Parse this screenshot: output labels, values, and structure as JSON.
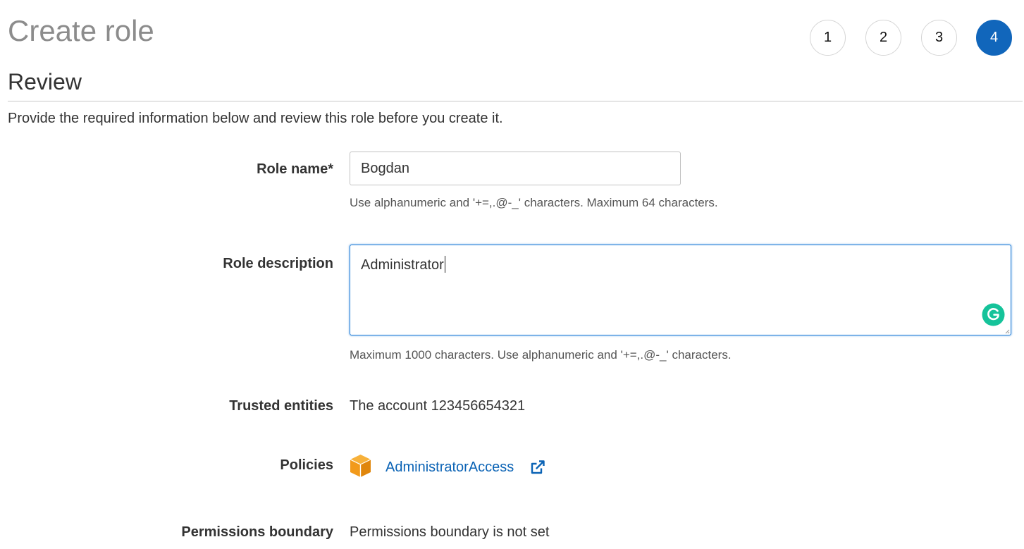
{
  "page": {
    "title": "Create role",
    "section_title": "Review",
    "intro": "Provide the required information below and review this role before you create it."
  },
  "steps": [
    {
      "label": "1",
      "active": false
    },
    {
      "label": "2",
      "active": false
    },
    {
      "label": "3",
      "active": false
    },
    {
      "label": "4",
      "active": true
    }
  ],
  "form": {
    "role_name": {
      "label": "Role name*",
      "value": "Bogdan",
      "hint": "Use alphanumeric and '+=,.@-_' characters. Maximum 64 characters."
    },
    "role_description": {
      "label": "Role description",
      "value": "Administrator",
      "hint": "Maximum 1000 characters. Use alphanumeric and '+=,.@-_' characters."
    },
    "trusted_entities": {
      "label": "Trusted entities",
      "value": "The account 123456654321"
    },
    "policies": {
      "label": "Policies",
      "items": [
        {
          "name": "AdministratorAccess",
          "icon": "aws-policy-box-icon"
        }
      ]
    },
    "permissions_boundary": {
      "label": "Permissions boundary",
      "value": "Permissions boundary is not set"
    }
  },
  "colors": {
    "accent": "#1166bb",
    "link": "#0b63b5",
    "focus_border": "#1c7ad6",
    "policy_icon": "#f29a1b",
    "grammarly": "#15c39a"
  },
  "icons": {
    "external_link": "external-link-icon",
    "grammarly": "grammarly-icon"
  }
}
